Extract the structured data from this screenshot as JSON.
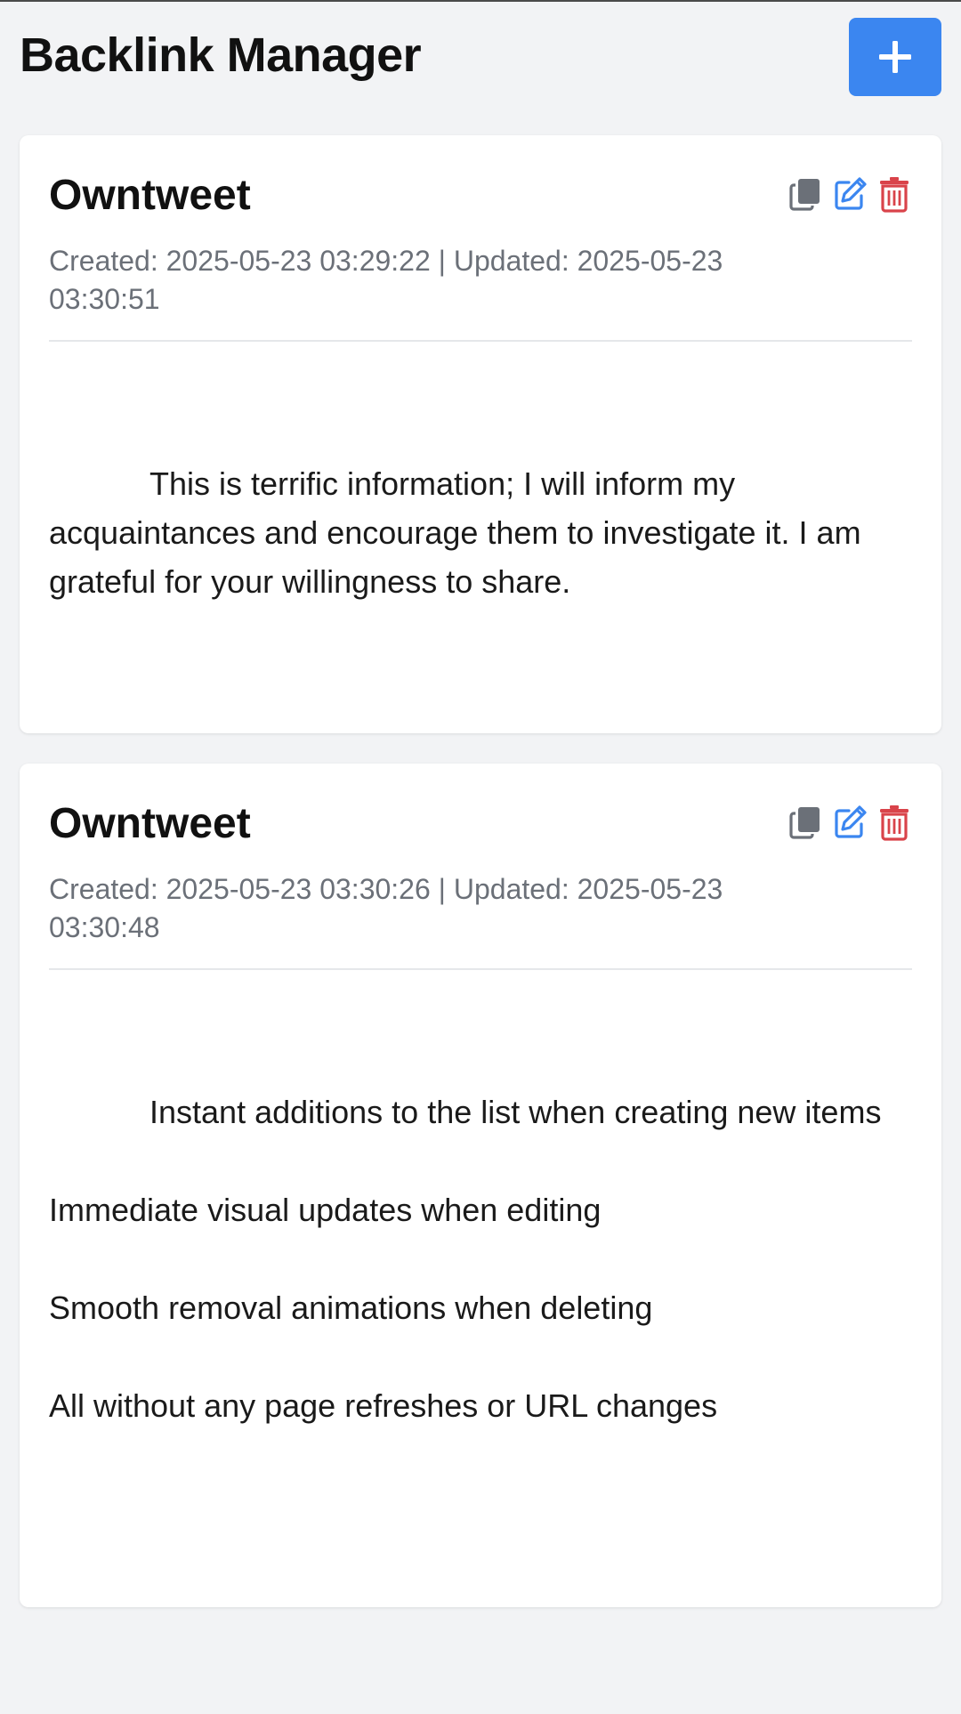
{
  "header": {
    "title": "Backlink Manager",
    "add_icon": "plus-icon"
  },
  "colors": {
    "accent": "#3b86f0",
    "copy_icon": "#6b7078",
    "edit_icon": "#3b86f0",
    "delete_icon": "#d9434a",
    "background": "#f2f3f5"
  },
  "cards": [
    {
      "title": "Owntweet",
      "meta": "Created: 2025-05-23 03:29:22 | Updated: 2025-05-23 03:30:51",
      "paragraphs": [
        "This is terrific information; I will inform my acquaintances and encourage them to investigate it. I am grateful for your willingness to share."
      ],
      "actions": [
        "copy-icon",
        "edit-icon",
        "trash-icon"
      ]
    },
    {
      "title": "Owntweet",
      "meta": "Created: 2025-05-23 03:30:26 | Updated: 2025-05-23 03:30:48",
      "paragraphs": [
        "Instant additions to the list when creating new items",
        "Immediate visual updates when editing",
        "Smooth removal animations when deleting",
        "All without any page refreshes or URL changes"
      ],
      "actions": [
        "copy-icon",
        "edit-icon",
        "trash-icon"
      ]
    }
  ]
}
